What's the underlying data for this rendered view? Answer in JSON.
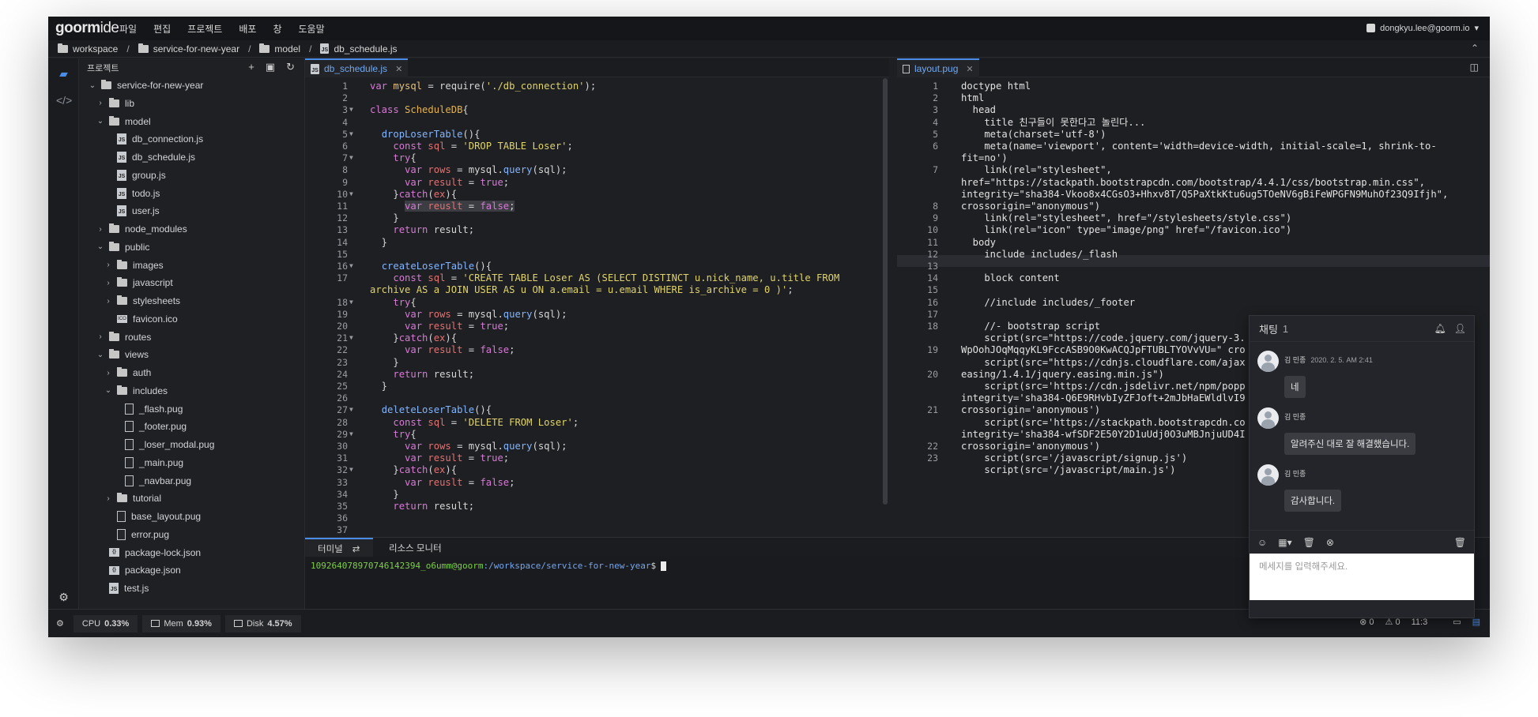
{
  "app": {
    "logo": "goorm",
    "logo_b": "ide"
  },
  "menu": [
    "파일",
    "편집",
    "프로젝트",
    "배포",
    "창",
    "도움말"
  ],
  "user": {
    "email": "dongkyu.lee@goorm.io",
    "caret": "▾"
  },
  "breadcrumb": [
    "workspace",
    "service-for-new-year",
    "model",
    "db_schedule.js"
  ],
  "sidebar": {
    "title": "프로젝트",
    "tree": [
      {
        "label": "service-for-new-year",
        "icon": "folder",
        "depth": 0,
        "open": true
      },
      {
        "label": "lib",
        "icon": "folder",
        "depth": 1,
        "open": false
      },
      {
        "label": "model",
        "icon": "folder",
        "depth": 1,
        "open": true
      },
      {
        "label": "db_connection.js",
        "icon": "js",
        "depth": 2
      },
      {
        "label": "db_schedule.js",
        "icon": "js",
        "depth": 2
      },
      {
        "label": "group.js",
        "icon": "js",
        "depth": 2
      },
      {
        "label": "todo.js",
        "icon": "js",
        "depth": 2
      },
      {
        "label": "user.js",
        "icon": "js",
        "depth": 2
      },
      {
        "label": "node_modules",
        "icon": "folder",
        "depth": 1,
        "open": false
      },
      {
        "label": "public",
        "icon": "folder",
        "depth": 1,
        "open": true
      },
      {
        "label": "images",
        "icon": "folder",
        "depth": 2,
        "open": false
      },
      {
        "label": "javascript",
        "icon": "folder",
        "depth": 2,
        "open": false
      },
      {
        "label": "stylesheets",
        "icon": "folder",
        "depth": 2,
        "open": false
      },
      {
        "label": "favicon.ico",
        "icon": "ico",
        "depth": 2
      },
      {
        "label": "routes",
        "icon": "folder",
        "depth": 1,
        "open": false
      },
      {
        "label": "views",
        "icon": "folder",
        "depth": 1,
        "open": true
      },
      {
        "label": "auth",
        "icon": "folder",
        "depth": 2,
        "open": false
      },
      {
        "label": "includes",
        "icon": "folder",
        "depth": 2,
        "open": true
      },
      {
        "label": "_flash.pug",
        "icon": "file",
        "depth": 3
      },
      {
        "label": "_footer.pug",
        "icon": "file",
        "depth": 3
      },
      {
        "label": "_loser_modal.pug",
        "icon": "file",
        "depth": 3
      },
      {
        "label": "_main.pug",
        "icon": "file",
        "depth": 3
      },
      {
        "label": "_navbar.pug",
        "icon": "file",
        "depth": 3
      },
      {
        "label": "tutorial",
        "icon": "folder",
        "depth": 2,
        "open": false
      },
      {
        "label": "base_layout.pug",
        "icon": "file",
        "depth": 2
      },
      {
        "label": "error.pug",
        "icon": "file",
        "depth": 2
      },
      {
        "label": "package-lock.json",
        "icon": "json",
        "depth": 1
      },
      {
        "label": "package.json",
        "icon": "json",
        "depth": 1
      },
      {
        "label": "test.js",
        "icon": "js",
        "depth": 1
      }
    ]
  },
  "editor_left": {
    "tab": "db_schedule.js",
    "lines": [
      [
        [
          "kw",
          "var "
        ],
        [
          "var",
          "mysql"
        ],
        [
          "plain",
          " = require("
        ],
        [
          "str",
          "'./db_connection'"
        ],
        [
          "plain",
          ");"
        ]
      ],
      [],
      [
        [
          "kw",
          "class "
        ],
        [
          "cls",
          "ScheduleDB"
        ],
        [
          "plain",
          "{"
        ]
      ],
      [],
      [
        [
          "plain",
          "  "
        ],
        [
          "fn",
          "dropLoserTable"
        ],
        [
          "plain",
          "(){"
        ]
      ],
      [
        [
          "plain",
          "    "
        ],
        [
          "kw",
          "const "
        ],
        [
          "red",
          "sql"
        ],
        [
          "plain",
          " = "
        ],
        [
          "str",
          "'DROP TABLE Loser'"
        ],
        [
          "plain",
          ";"
        ]
      ],
      [
        [
          "plain",
          "    "
        ],
        [
          "kw",
          "try"
        ],
        [
          "plain",
          "{"
        ]
      ],
      [
        [
          "plain",
          "      "
        ],
        [
          "kw",
          "var "
        ],
        [
          "red",
          "rows"
        ],
        [
          "plain",
          " = mysql."
        ],
        [
          "fn",
          "query"
        ],
        [
          "plain",
          "(sql);"
        ]
      ],
      [
        [
          "plain",
          "      "
        ],
        [
          "kw",
          "var "
        ],
        [
          "red",
          "result"
        ],
        [
          "plain",
          " = "
        ],
        [
          "lit",
          "true"
        ],
        [
          "plain",
          ";"
        ]
      ],
      [
        [
          "plain",
          "    }"
        ],
        [
          "kw",
          "catch"
        ],
        [
          "plain",
          "("
        ],
        [
          "red",
          "ex"
        ],
        [
          "plain",
          "){"
        ]
      ],
      [
        [
          "plain",
          "      "
        ],
        [
          "kw",
          "var "
        ],
        [
          "red",
          "reuslt"
        ],
        [
          "plain",
          " = "
        ],
        [
          "lit",
          "false"
        ],
        [
          "plain",
          ";"
        ]
      ],
      [
        [
          "plain",
          "    }"
        ]
      ],
      [
        [
          "plain",
          "    "
        ],
        [
          "kw",
          "return "
        ],
        [
          "plain",
          "result;"
        ]
      ],
      [
        [
          "plain",
          "  }"
        ]
      ],
      [],
      [
        [
          "plain",
          "  "
        ],
        [
          "fn",
          "createLoserTable"
        ],
        [
          "plain",
          "(){"
        ]
      ],
      [
        [
          "plain",
          "    "
        ],
        [
          "kw",
          "const "
        ],
        [
          "red",
          "sql"
        ],
        [
          "plain",
          " = "
        ],
        [
          "str",
          "'CREATE TABLE Loser AS (SELECT DISTINCT u.nick_name, u.title FROM"
        ]
      ],
      [
        [
          "str",
          "archive AS a JOIN USER AS u ON a.email = u.email WHERE is_archive = 0 )'"
        ],
        [
          "plain",
          ";"
        ]
      ],
      [
        [
          "plain",
          "    "
        ],
        [
          "kw",
          "try"
        ],
        [
          "plain",
          "{"
        ]
      ],
      [
        [
          "plain",
          "      "
        ],
        [
          "kw",
          "var "
        ],
        [
          "red",
          "rows"
        ],
        [
          "plain",
          " = mysql."
        ],
        [
          "fn",
          "query"
        ],
        [
          "plain",
          "(sql);"
        ]
      ],
      [
        [
          "plain",
          "      "
        ],
        [
          "kw",
          "var "
        ],
        [
          "red",
          "result"
        ],
        [
          "plain",
          " = "
        ],
        [
          "lit",
          "true"
        ],
        [
          "plain",
          ";"
        ]
      ],
      [
        [
          "plain",
          "    }"
        ],
        [
          "kw",
          "catch"
        ],
        [
          "plain",
          "("
        ],
        [
          "red",
          "ex"
        ],
        [
          "plain",
          "){"
        ]
      ],
      [
        [
          "plain",
          "      "
        ],
        [
          "kw",
          "var "
        ],
        [
          "red",
          "result"
        ],
        [
          "plain",
          " = "
        ],
        [
          "lit",
          "false"
        ],
        [
          "plain",
          ";"
        ]
      ],
      [
        [
          "plain",
          "    }"
        ]
      ],
      [
        [
          "plain",
          "    "
        ],
        [
          "kw",
          "return "
        ],
        [
          "plain",
          "result;"
        ]
      ],
      [
        [
          "plain",
          "  }"
        ]
      ],
      [],
      [
        [
          "plain",
          "  "
        ],
        [
          "fn",
          "deleteLoserTable"
        ],
        [
          "plain",
          "(){"
        ]
      ],
      [
        [
          "plain",
          "    "
        ],
        [
          "kw",
          "const "
        ],
        [
          "red",
          "sql"
        ],
        [
          "plain",
          " = "
        ],
        [
          "str",
          "'DELETE FROM Loser'"
        ],
        [
          "plain",
          ";"
        ]
      ],
      [
        [
          "plain",
          "    "
        ],
        [
          "kw",
          "try"
        ],
        [
          "plain",
          "{"
        ]
      ],
      [
        [
          "plain",
          "      "
        ],
        [
          "kw",
          "var "
        ],
        [
          "red",
          "rows"
        ],
        [
          "plain",
          " = mysql."
        ],
        [
          "fn",
          "query"
        ],
        [
          "plain",
          "(sql);"
        ]
      ],
      [
        [
          "plain",
          "      "
        ],
        [
          "kw",
          "var "
        ],
        [
          "red",
          "result"
        ],
        [
          "plain",
          " = "
        ],
        [
          "lit",
          "true"
        ],
        [
          "plain",
          ";"
        ]
      ],
      [
        [
          "plain",
          "    }"
        ],
        [
          "kw",
          "catch"
        ],
        [
          "plain",
          "("
        ],
        [
          "red",
          "ex"
        ],
        [
          "plain",
          "){"
        ]
      ],
      [
        [
          "plain",
          "      "
        ],
        [
          "kw",
          "var "
        ],
        [
          "red",
          "reuslt"
        ],
        [
          "plain",
          " = "
        ],
        [
          "lit",
          "false"
        ],
        [
          "plain",
          ";"
        ]
      ],
      [
        [
          "plain",
          "    }"
        ]
      ],
      [
        [
          "plain",
          "    "
        ],
        [
          "kw",
          "return "
        ],
        [
          "plain",
          "result;"
        ]
      ],
      [],
      []
    ],
    "line_numbers": [
      "1",
      "2",
      "3",
      "4",
      "5",
      "6",
      "7",
      "8",
      "9",
      "10",
      "11",
      "12",
      "13",
      "14",
      "15",
      "16",
      "17",
      "",
      "18",
      "19",
      "20",
      "21",
      "22",
      "23",
      "24",
      "25",
      "26",
      "27",
      "28",
      "29",
      "30",
      "31",
      "32",
      "33",
      "34",
      "35",
      "36",
      "37"
    ],
    "folds": [
      "3",
      "5",
      "7",
      "10",
      "16",
      "18",
      "21",
      "27",
      "29",
      "32"
    ]
  },
  "editor_right": {
    "tab": "layout.pug",
    "line_numbers": [
      "1",
      "2",
      "3",
      "4",
      "5",
      "6",
      "",
      "7",
      "",
      "",
      "8",
      "9",
      "10",
      "11",
      "12",
      "13",
      "14",
      "15",
      "16",
      "17",
      "18",
      "",
      "19",
      "",
      "20",
      "",
      "",
      "21",
      "",
      "",
      "22",
      "23"
    ],
    "lines": [
      "doctype html",
      "html",
      "  head",
      "    title 친구들이 못한다고 놀린다...",
      "    meta(charset='utf-8')",
      "    meta(name='viewport', content='width=device-width, initial-scale=1, shrink-to-",
      "fit=no')",
      "    link(rel=\"stylesheet\",",
      "href=\"https://stackpath.bootstrapcdn.com/bootstrap/4.4.1/css/bootstrap.min.css\",",
      "integrity=\"sha384-Vkoo8x4CGsO3+Hhxv8T/Q5PaXtkKtu6ug5TOeNV6gBiFeWPGFN9MuhOf23Q9Ifjh\",",
      "crossorigin=\"anonymous\")",
      "    link(rel=\"stylesheet\", href=\"/stylesheets/style.css\")",
      "    link(rel=\"icon\" type=\"image/png\" href=\"/favicon.ico\")",
      "  body",
      "    include includes/_flash",
      "",
      "    block content",
      "",
      "    //include includes/_footer",
      "",
      "    //- bootstrap script",
      "    script(src=\"https://code.jquery.com/jquery-3.",
      "WpOohJOqMqqyKL9FccASB9O0KwACQJpFTUBLTYOVvVU=\" cro",
      "    script(src=\"https://cdnjs.cloudflare.com/ajax",
      "easing/1.4.1/jquery.easing.min.js\")",
      "    script(src='https://cdn.jsdelivr.net/npm/popp",
      "integrity='sha384-Q6E9RHvbIyZFJoft+2mJbHaEWldlvI9",
      "crossorigin='anonymous')",
      "    script(src='https://stackpath.bootstrapcdn.co",
      "integrity='sha384-wfSDF2E50Y2D1uUdj0O3uMBJnjuUD4I",
      "crossorigin='anonymous')",
      "    script(src='/javascript/signup.js')",
      "    script(src='/javascript/main.js')"
    ]
  },
  "terminal": {
    "tab_terminal": "터미널",
    "tab_monitor": "리소스 모니터",
    "prompt_user": "1092640789707461423​94_o6umm@goorm",
    "prompt_path": ":/workspace/service-for-new-year",
    "prompt_end": "$"
  },
  "status": {
    "cpu_label": "CPU",
    "cpu": "0.33%",
    "mem_label": "Mem",
    "mem": "0.93%",
    "disk_label": "Disk",
    "disk": "4.57%",
    "errors": "0",
    "warnings": "0",
    "position": "11:3"
  },
  "chat": {
    "title": "채팅",
    "count": "1",
    "messages": [
      {
        "name": "김 민종",
        "time": "2020. 2. 5. AM 2:41",
        "text": "네"
      },
      {
        "name": "김 민종",
        "time": "",
        "text": "알려주신 대로 잘 해결했습니다."
      },
      {
        "name": "김 민종",
        "time": "",
        "text": "감사합니다."
      }
    ],
    "input_placeholder": "메세지를 입력해주세요."
  }
}
